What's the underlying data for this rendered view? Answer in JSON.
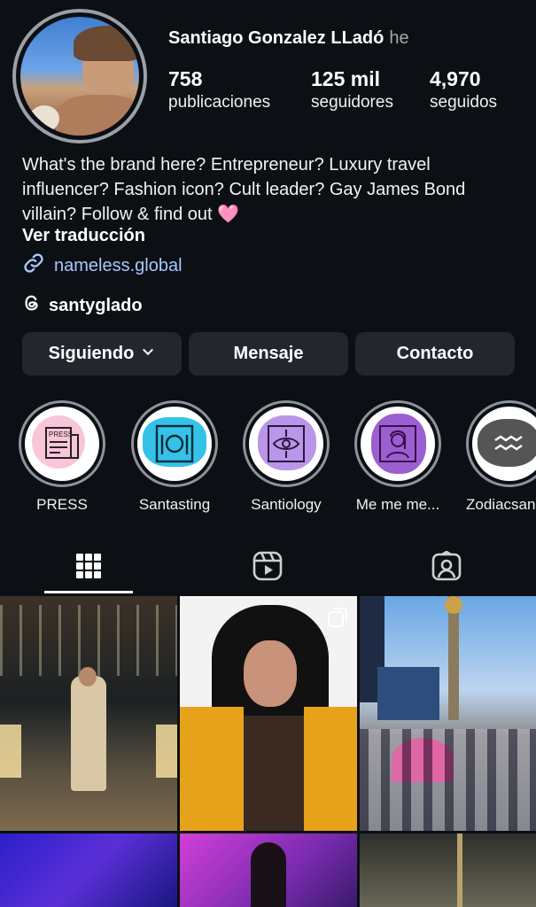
{
  "profile": {
    "name": "Santiago Gonzalez LLadó",
    "pronouns": "he",
    "stats": [
      {
        "value": "758",
        "label": "publicaciones"
      },
      {
        "value": "125 mil",
        "label": "seguidores"
      },
      {
        "value": "4,970",
        "label": "seguidos"
      }
    ],
    "bio": "What's the brand here? Entrepreneur? Luxury travel influencer? Fashion icon? Cult leader? Gay James Bond villain? Follow & find out 🩷",
    "translate_label": "Ver traducción",
    "link": "nameless.global",
    "threads_handle": "santyglado"
  },
  "actions": {
    "following_label": "Siguiendo",
    "message_label": "Mensaje",
    "contact_label": "Contacto"
  },
  "highlights": [
    {
      "label": "PRESS"
    },
    {
      "label": "Santasting"
    },
    {
      "label": "Santiology"
    },
    {
      "label": "Me me me..."
    },
    {
      "label": "Zodiacsan"
    }
  ],
  "tabs": [
    "grid-icon",
    "reels-icon",
    "tagged-icon"
  ],
  "icons": {
    "link": "link-icon",
    "threads": "threads-icon",
    "dropdown": "chevron-down-icon",
    "carousel": "carousel-icon"
  },
  "colors": {
    "background": "#0c0f14",
    "button": "#23262d",
    "link": "#a7c8ff"
  }
}
